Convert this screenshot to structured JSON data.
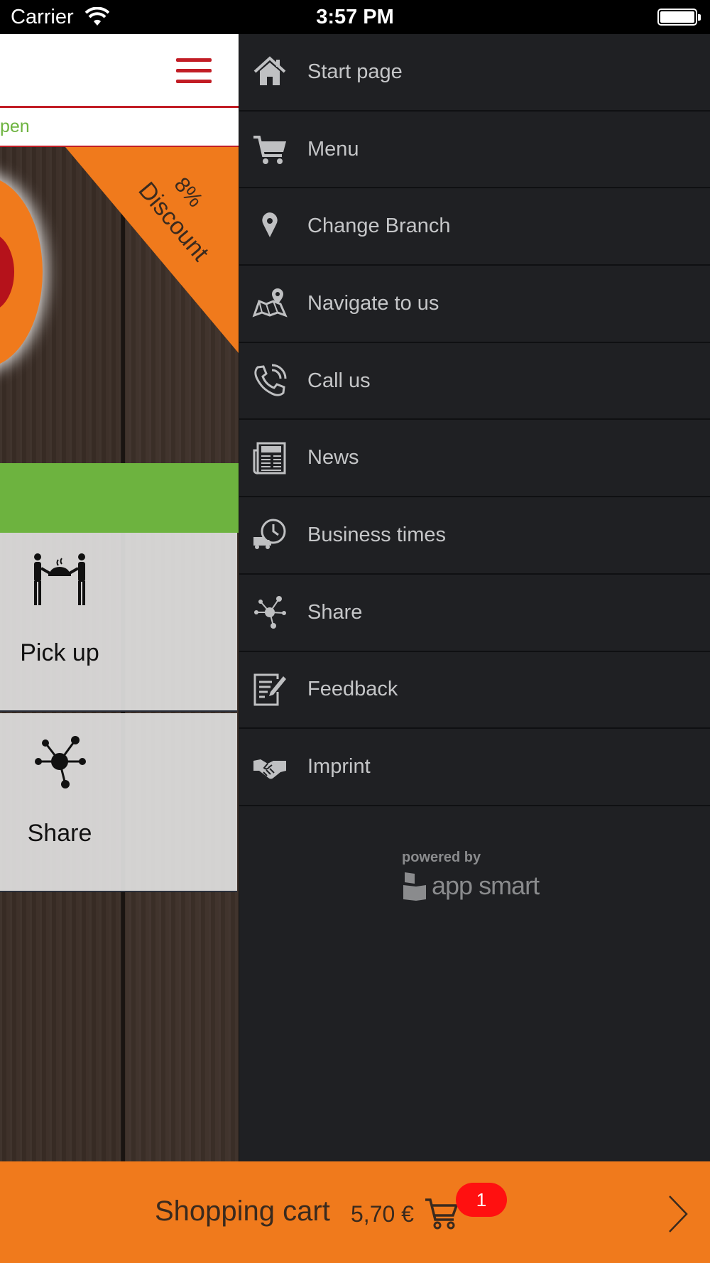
{
  "status_bar": {
    "carrier": "Carrier",
    "time": "3:57 PM"
  },
  "app": {
    "open_status": "pen",
    "discount_percent": "8%",
    "discount_label": "Discount",
    "tiles": [
      {
        "label": "Pick up",
        "icon": "pickup-icon"
      },
      {
        "label": "Share",
        "icon": "share-icon"
      }
    ]
  },
  "drawer": {
    "items": [
      {
        "label": "Start page",
        "icon": "home-icon"
      },
      {
        "label": "Menu",
        "icon": "cart-icon"
      },
      {
        "label": "Change Branch",
        "icon": "location-pin-icon"
      },
      {
        "label": "Navigate to us",
        "icon": "map-icon"
      },
      {
        "label": "Call us",
        "icon": "phone-icon"
      },
      {
        "label": "News",
        "icon": "newspaper-icon"
      },
      {
        "label": "Business times",
        "icon": "delivery-clock-icon"
      },
      {
        "label": "Share",
        "icon": "share-icon"
      },
      {
        "label": "Feedback",
        "icon": "feedback-icon"
      },
      {
        "label": "Imprint",
        "icon": "handshake-icon"
      }
    ],
    "powered_by": "powered by",
    "brand": "app smart"
  },
  "cart": {
    "label": "Shopping cart",
    "amount": "5,70 €",
    "count": "1"
  },
  "colors": {
    "accent_orange": "#f07a1c",
    "brand_red": "#c21d25",
    "open_green": "#6db33f",
    "drawer_bg": "#1f2023"
  }
}
